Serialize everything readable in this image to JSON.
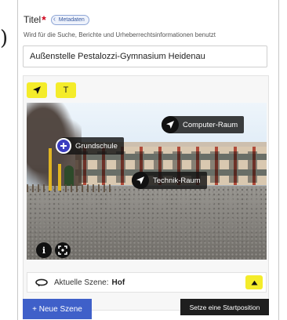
{
  "decor": {
    "paren": ")"
  },
  "form": {
    "title_label": "Titel",
    "required_mark": "*",
    "metadata_badge": "Metadaten",
    "hint": "Wird für die Suche, Berichte und Urheberrechtsinformationen benutzt",
    "title_value": "Außenstelle Pestalozzi-Gymnasium Heidenau"
  },
  "toolbar": {
    "arrow_tool_icon": "navigation-arrow-icon",
    "text_tool_label": "T"
  },
  "hotspots": [
    {
      "label": "Computer-Raum",
      "icon": "navigation-arrow-icon"
    },
    {
      "label": "Grundschule",
      "icon": "plus-circle-icon"
    },
    {
      "label": "Technik-Raum",
      "icon": "navigation-arrow-icon"
    }
  ],
  "viewer_buttons": {
    "info_label": "i",
    "fullscreen_icon": "fullscreen-icon"
  },
  "scene": {
    "label": "Aktuelle Szene:",
    "value": "Hof",
    "icon": "rotate-360-icon",
    "collapse_icon": "triangle-up-icon"
  },
  "actions": {
    "new_scene": "+ Neue Szene",
    "set_start": "Setze eine Startposition"
  },
  "colors": {
    "accent_yellow": "#f4ec2a",
    "primary_blue": "#3f60c9",
    "dark_button": "#1e1e1e",
    "required_red": "#d0021b"
  }
}
